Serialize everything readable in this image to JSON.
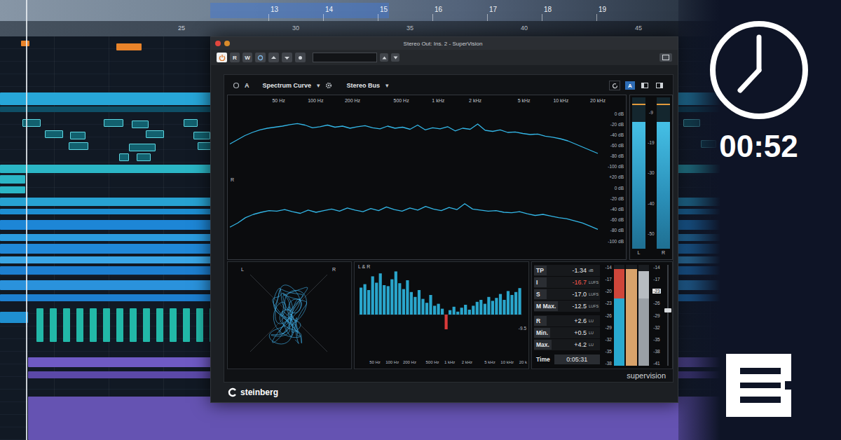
{
  "daw": {
    "ruler_bars": [
      "13",
      "14",
      "15",
      "16",
      "17",
      "18",
      "19"
    ],
    "ruler_times": [
      "25",
      "30",
      "35",
      "40",
      "45"
    ]
  },
  "plugin": {
    "title": "Stereo Out: Ins. 2 - SuperVision",
    "power_on": true,
    "toolbar": [
      {
        "label": "R",
        "selected": false
      },
      {
        "label": "W",
        "selected": false
      }
    ],
    "header": {
      "slot": "A",
      "module": "Spectrum Curve",
      "bus": "Stereo Bus",
      "arrow": "▾",
      "view": {
        "label": "A",
        "selected": true
      }
    },
    "spectrum": {
      "channel_label": "R",
      "freq_ticks": [
        {
          "label": "50 Hz",
          "hz": 50
        },
        {
          "label": "100 Hz",
          "hz": 100
        },
        {
          "label": "200 Hz",
          "hz": 200
        },
        {
          "label": "500 Hz",
          "hz": 500
        },
        {
          "label": "1 kHz",
          "hz": 1000
        },
        {
          "label": "2 kHz",
          "hz": 2000
        },
        {
          "label": "5 kHz",
          "hz": 5000
        },
        {
          "label": "10 kHz",
          "hz": 10000
        },
        {
          "label": "20 kHz",
          "hz": 20000
        }
      ],
      "db_ticks_top": [
        {
          "label": "0 dB",
          "db": 0
        },
        {
          "label": "-20 dB",
          "db": -20
        },
        {
          "label": "-40 dB",
          "db": -40
        },
        {
          "label": "-60 dB",
          "db": -60
        },
        {
          "label": "-80 dB",
          "db": -80
        },
        {
          "label": "-100 dB",
          "db": -100
        }
      ],
      "db_ticks_bottom": [
        {
          "label": "+20 dB",
          "db": 20
        },
        {
          "label": "0 dB",
          "db": 0
        },
        {
          "label": "-20 dB",
          "db": -20
        },
        {
          "label": "-40 dB",
          "db": -40
        },
        {
          "label": "-60 dB",
          "db": -60
        },
        {
          "label": "-80 dB",
          "db": -80
        },
        {
          "label": "-100 dB",
          "db": -100
        }
      ],
      "series": [
        {
          "values": [
            -58,
            -50,
            -42,
            -36,
            -31,
            -28,
            -26,
            -24,
            -21,
            -19,
            -22,
            -27,
            -25,
            -22,
            -26,
            -24,
            -28,
            -25,
            -23,
            -27,
            -29,
            -24,
            -28,
            -26,
            -30,
            -22,
            -31,
            -27,
            -29,
            -25,
            -33,
            -28,
            -30,
            -20,
            -32,
            -34,
            -31,
            -36,
            -35,
            -38,
            -40,
            -39,
            -43,
            -45,
            -48,
            -52,
            -58,
            -64,
            -70,
            -76
          ]
        },
        {
          "values": [
            -74,
            -66,
            -56,
            -50,
            -46,
            -43,
            -44,
            -41,
            -45,
            -48,
            -42,
            -46,
            -43,
            -40,
            -44,
            -38,
            -42,
            -45,
            -39,
            -43,
            -36,
            -41,
            -44,
            -38,
            -42,
            -35,
            -40,
            -43,
            -37,
            -41,
            -30,
            -40,
            -42,
            -44,
            -43,
            -46,
            -47,
            -45,
            -49,
            -52,
            -50,
            -53,
            -56,
            -58,
            -62,
            -66,
            -72,
            -78
          ]
        }
      ]
    },
    "level_meter": {
      "scale": [
        "-9",
        "-19",
        "-30",
        "-40",
        "-50"
      ],
      "channels": [
        {
          "label": "L",
          "level": 0.84,
          "hold": 0.95
        },
        {
          "label": "R",
          "level": 0.84,
          "hold": 0.95
        }
      ]
    },
    "phase_scope": {
      "left": "L",
      "right": "R"
    },
    "multiband": {
      "title": "L & R",
      "reading": "-9.5",
      "freq_ticks": [
        {
          "label": "50 Hz",
          "hz": 50
        },
        {
          "label": "100 Hz",
          "hz": 100
        },
        {
          "label": "200 Hz",
          "hz": 200
        },
        {
          "label": "500 Hz",
          "hz": 500
        },
        {
          "label": "1 kHz",
          "hz": 1000
        },
        {
          "label": "2 kHz",
          "hz": 2000
        },
        {
          "label": "5 kHz",
          "hz": 5000
        },
        {
          "label": "10 kHz",
          "hz": 10000
        },
        {
          "label": "20 k",
          "hz": 20000
        }
      ],
      "values": [
        5.5,
        6.2,
        5.0,
        7.8,
        6.5,
        8.4,
        6.0,
        5.8,
        7.2,
        8.8,
        6.4,
        5.2,
        7.0,
        4.6,
        3.6,
        5.0,
        3.2,
        2.4,
        4.0,
        1.8,
        2.2,
        1.2,
        -3.0,
        0.9,
        1.6,
        0.6,
        1.4,
        2.0,
        1.0,
        1.8,
        2.6,
        3.0,
        2.2,
        3.6,
        2.8,
        3.4,
        4.2,
        3.0,
        4.8,
        4.0,
        4.6,
        5.4
      ]
    },
    "loudness": {
      "rows": [
        {
          "label": "TP",
          "value": "-1.34",
          "unit": "dB",
          "alert": false
        },
        {
          "label": "I",
          "value": "-16.7",
          "unit": "LUFS",
          "alert": true
        },
        {
          "label": "S",
          "value": "-17.0",
          "unit": "LUFS",
          "alert": false
        },
        {
          "label": "M Max.",
          "value": "-12.5",
          "unit": "LUFS",
          "alert": false
        }
      ],
      "range_rows": [
        {
          "label": "R",
          "value": "+2.6",
          "unit": "LU"
        },
        {
          "label": "Min.",
          "value": "+0.5",
          "unit": "LU"
        },
        {
          "label": "Max.",
          "value": "+4.2",
          "unit": "LU"
        }
      ],
      "time": {
        "label": "Time",
        "value": "0:05:31"
      },
      "scale_left": [
        "-14",
        "-17",
        "-20",
        "-23",
        "-26",
        "-29",
        "-32",
        "-35",
        "-38"
      ],
      "scale_right": [
        {
          "label": "-14",
          "highlighted": false
        },
        {
          "label": "-17",
          "highlighted": false
        },
        {
          "label": "-23",
          "highlighted": true
        },
        {
          "label": "-26",
          "highlighted": false
        },
        {
          "label": "-29",
          "highlighted": false
        },
        {
          "label": "-32",
          "highlighted": false
        },
        {
          "label": "-35",
          "highlighted": false
        },
        {
          "label": "-38",
          "highlighted": false
        },
        {
          "label": "-41",
          "highlighted": false
        }
      ],
      "target_level": 0.67,
      "bars": [
        {
          "level": 0.96,
          "color": "#29a9cf",
          "over_color": "#d0463a"
        },
        {
          "level": 0.96,
          "color": "#d9a36b",
          "over_color": "#d9a36b"
        },
        {
          "level": 0.94,
          "color": "#9aa0a6",
          "over_color": "#b7bcc1"
        }
      ],
      "fader": {
        "level": 0.55
      }
    },
    "module_name": "supervision",
    "brand": "steinberg"
  },
  "overlay": {
    "timer": "00:52"
  }
}
